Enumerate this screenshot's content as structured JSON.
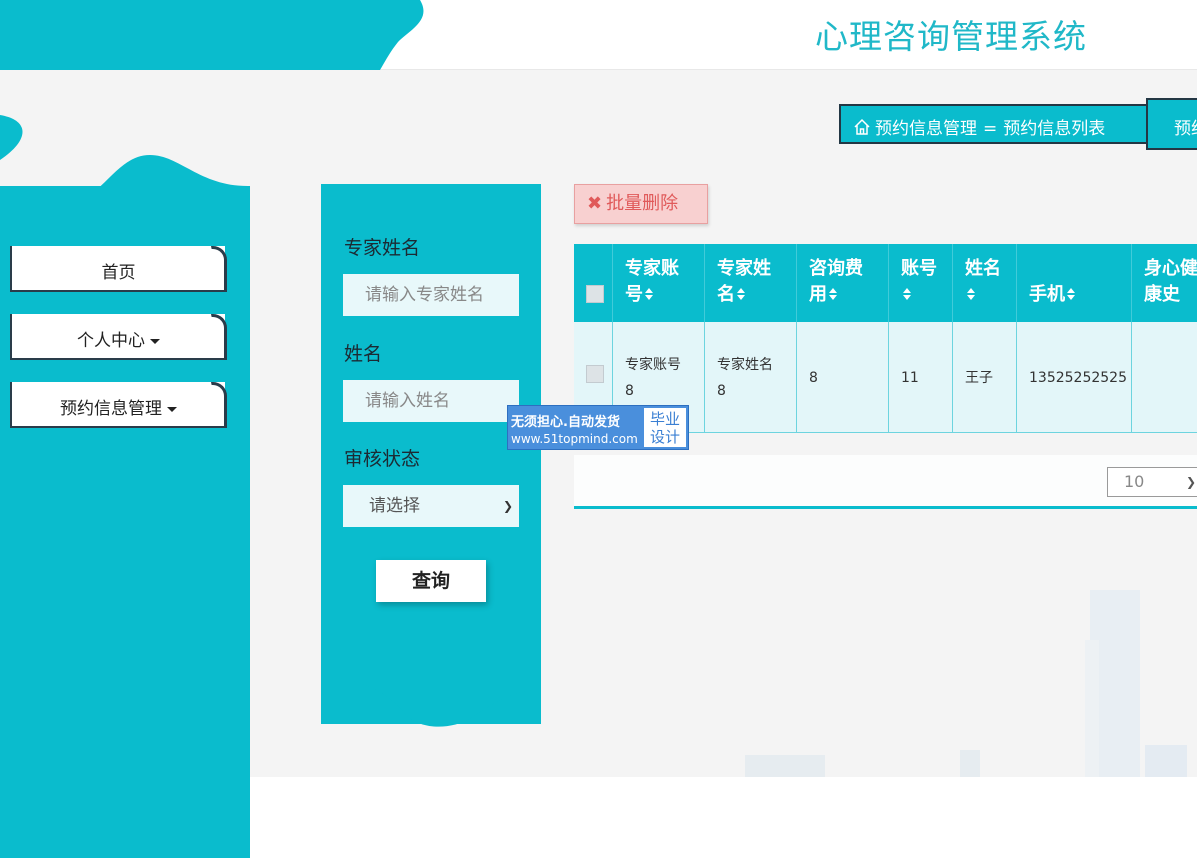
{
  "header": {
    "title": "心理咨询管理系统"
  },
  "sidebar": {
    "items": [
      {
        "label": "首页",
        "has_dropdown": false
      },
      {
        "label": "个人中心",
        "has_dropdown": true
      },
      {
        "label": "预约信息管理",
        "has_dropdown": true
      }
    ]
  },
  "breadcrumb": {
    "home_icon": "home-icon",
    "section": "预约信息管理",
    "separator": "=",
    "page": "预约信息列表",
    "tab_label": "预约"
  },
  "search": {
    "fields": [
      {
        "label": "专家姓名",
        "placeholder": "请输入专家姓名"
      },
      {
        "label": "姓名",
        "placeholder": "请输入姓名"
      }
    ],
    "status": {
      "label": "审核状态",
      "selected": "请选择"
    },
    "query_label": "查询"
  },
  "watermark": {
    "line1": "无须担心.自动发货",
    "url": "www.51topmind.com",
    "badge_line1": "毕业",
    "badge_line2": "设计"
  },
  "toolbar": {
    "batch_delete_label": "批量删除",
    "batch_delete_icon": "close-icon"
  },
  "table": {
    "columns": [
      {
        "line1": "专家账",
        "line2": "号"
      },
      {
        "line1": "专家姓",
        "line2": "名"
      },
      {
        "line1": "咨询费",
        "line2": "用"
      },
      {
        "line1": "账号",
        "line2": ""
      },
      {
        "line1": "姓名",
        "line2": ""
      },
      {
        "line1": "",
        "line2": "手机"
      },
      {
        "line1": "身心健",
        "line2": "康史"
      }
    ],
    "sort_icon": "sort-icon",
    "rows": [
      {
        "expert_account_line1": "专家账号",
        "expert_account_line2": "8",
        "expert_name_line1": "专家姓名",
        "expert_name_line2": "8",
        "fee": "8",
        "account": "11",
        "name": "王子",
        "phone": "13525252525",
        "health_history": ""
      }
    ]
  },
  "pagination": {
    "page_size": "10"
  },
  "colors": {
    "primary": "#0abccd",
    "title": "#20b8c8",
    "delete_bg": "#f8d0d0",
    "delete_text": "#e05a5a",
    "dark_border": "#233744"
  }
}
